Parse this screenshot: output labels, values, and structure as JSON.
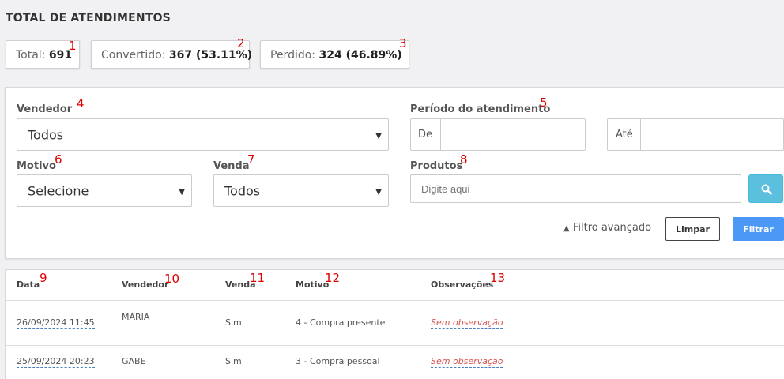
{
  "page": {
    "title": "TOTAL DE ATENDIMENTOS"
  },
  "stats": {
    "total": {
      "label": "Total:",
      "value": "691"
    },
    "converted": {
      "label": "Convertido:",
      "value": "367 (53.11%)"
    },
    "lost": {
      "label": "Perdido:",
      "value": "324 (46.89%)"
    }
  },
  "annotations": [
    "1",
    "2",
    "3",
    "4",
    "5",
    "6",
    "7",
    "8",
    "9",
    "10",
    "11",
    "12",
    "13"
  ],
  "filters": {
    "seller": {
      "label": "Vendedor",
      "value": "Todos"
    },
    "period": {
      "label": "Período do atendimento",
      "from_label": "De",
      "to_label": "Até"
    },
    "reason": {
      "label": "Motivo",
      "value": "Selecione"
    },
    "sale": {
      "label": "Venda",
      "value": "Todos"
    },
    "products": {
      "label": "Produtos",
      "placeholder": "Digite aqui"
    },
    "advanced_label": "Filtro avançado",
    "clear_label": "Limpar",
    "filter_label": "Filtrar"
  },
  "table": {
    "headers": [
      "Data",
      "Vendedor",
      "Venda",
      "Motivo",
      "Observações"
    ],
    "rows": [
      {
        "date": "26/09/2024 11:45",
        "seller": "MARIA",
        "sale": "Sim",
        "reason": "4 - Compra presente",
        "obs": "Sem observação"
      },
      {
        "date": "25/09/2024 20:23",
        "seller": "GABE",
        "sale": "Sim",
        "reason": "3 - Compra pessoal",
        "obs": "Sem observação"
      }
    ]
  },
  "colors": {
    "accent": "#4c98f7",
    "search": "#5bc0de",
    "annotation": "#dd0000",
    "observation": "#d9534f"
  }
}
